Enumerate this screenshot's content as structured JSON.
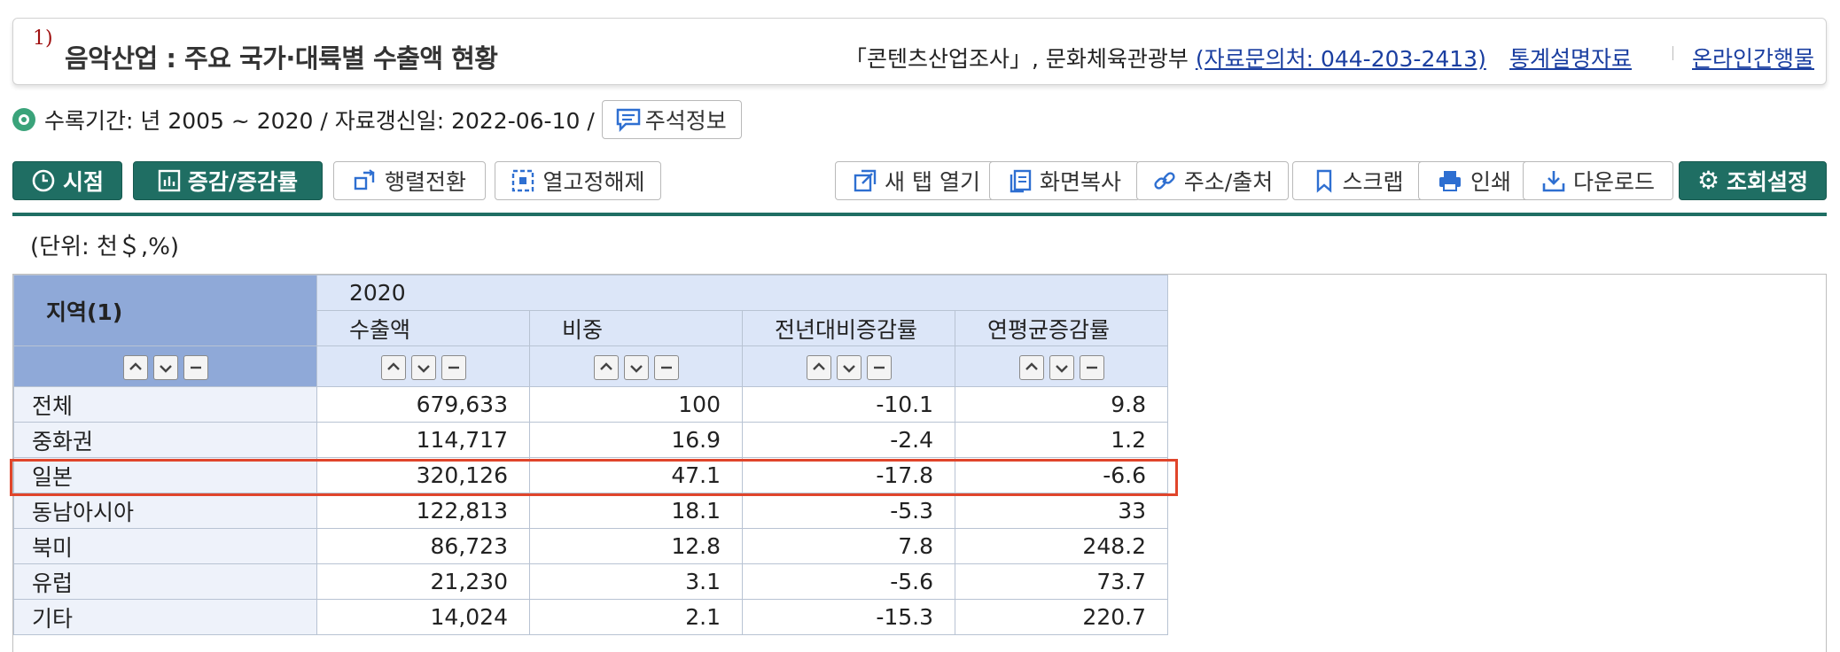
{
  "header": {
    "footnote_num": "1)",
    "title": "음악산업 : 주요 국가·대륙별 수출액 현황",
    "source_prefix": "「콘텐츠산업조사」, 문화체육관광부 ",
    "source_link": "(자료문의처: 044-203-2413)",
    "links": [
      "통계설명자료",
      "온라인간행물"
    ]
  },
  "info": {
    "period_text": "수록기간: 년 2005 ~ 2020 / 자료갱신일: 2022-06-10 /",
    "note_button": "주석정보"
  },
  "toolbar": {
    "left_buttons": [
      "시점",
      "증감/증감률",
      "행렬전환",
      "열고정해제"
    ],
    "right_buttons": [
      "새 탭 열기",
      "화면복사",
      "주소/출처",
      "스크랩",
      "인쇄",
      "다운로드",
      "조회설정"
    ]
  },
  "unit": "(단위: 천＄,%)",
  "table": {
    "region_header": "지역(1)",
    "year": "2020",
    "columns": [
      "수출액",
      "비중",
      "전년대비증감률",
      "연평균증감률"
    ],
    "rows": [
      {
        "region": "전체",
        "values": [
          "679,633",
          "100",
          "-10.1",
          "9.8"
        ]
      },
      {
        "region": "중화권",
        "values": [
          "114,717",
          "16.9",
          "-2.4",
          "1.2"
        ]
      },
      {
        "region": "일본",
        "values": [
          "320,126",
          "47.1",
          "-17.8",
          "-6.6"
        ]
      },
      {
        "region": "동남아시아",
        "values": [
          "122,813",
          "18.1",
          "-5.3",
          "33"
        ]
      },
      {
        "region": "북미",
        "values": [
          "86,723",
          "12.8",
          "7.8",
          "248.2"
        ]
      },
      {
        "region": "유럽",
        "values": [
          "21,230",
          "3.1",
          "-5.6",
          "73.7"
        ]
      },
      {
        "region": "기타",
        "values": [
          "14,024",
          "2.1",
          "-15.3",
          "220.7"
        ]
      }
    ]
  },
  "colors": {
    "accent": "#1f6e63",
    "highlight": "#e0452b",
    "header_blue": "#8fa9d8"
  }
}
